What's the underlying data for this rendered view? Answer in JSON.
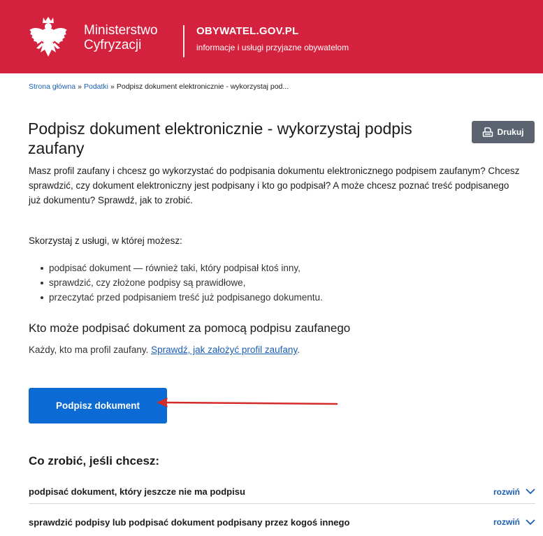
{
  "header": {
    "ministry_line1": "Ministerstwo",
    "ministry_line2": "Cyfryzacji",
    "portal_name": "OBYWATEL.GOV.PL",
    "portal_tagline": "informacje i usługi przyjazne obywatelom"
  },
  "breadcrumb": {
    "items": [
      "Strona główna",
      "Podatki"
    ],
    "separator": "»",
    "current": "Podpisz dokument elektronicznie - wykorzystaj pod..."
  },
  "page": {
    "title": "Podpisz dokument elektronicznie - wykorzystaj podpis zaufany",
    "print_label": "Drukuj",
    "intro": "Masz profil zaufany i chcesz go wykorzystać do podpisania dokumentu elektronicznego podpisem zaufanym? Chcesz sprawdzić, czy dokument elektroniczny jest podpisany i kto go podpisał? A może chcesz poznać treść podpisanego już dokumentu? Sprawdź, jak to zrobić.",
    "service_intro": "Skorzystaj z usługi, w której możesz:",
    "service_items": [
      "podpisać dokument — również taki, który podpisał ktoś inny,",
      "sprawdzić, czy złożone podpisy są prawidłowe,",
      "przeczytać przed podpisaniem treść już podpisanego dokumentu."
    ],
    "who_heading": "Kto może podpisać dokument za pomocą podpisu zaufanego",
    "who_text": "Każdy, kto ma profil zaufany.",
    "who_link": "Sprawdź, jak założyć profil zaufany",
    "who_end": ".",
    "sign_button": "Podpisz dokument",
    "what_heading": "Co zrobić, jeśli chcesz:",
    "accordion": [
      {
        "label": "podpisać dokument, który jeszcze nie ma podpisu",
        "toggle": "rozwiń"
      },
      {
        "label": "sprawdzić podpisy lub podpisać dokument podpisany przez kogoś innego",
        "toggle": "rozwiń"
      }
    ]
  },
  "colors": {
    "header_red": "#d4213d",
    "primary_blue": "#0b6ad3",
    "link_blue": "#1a5fb4",
    "annotation_arrow": "#d42a2a"
  }
}
